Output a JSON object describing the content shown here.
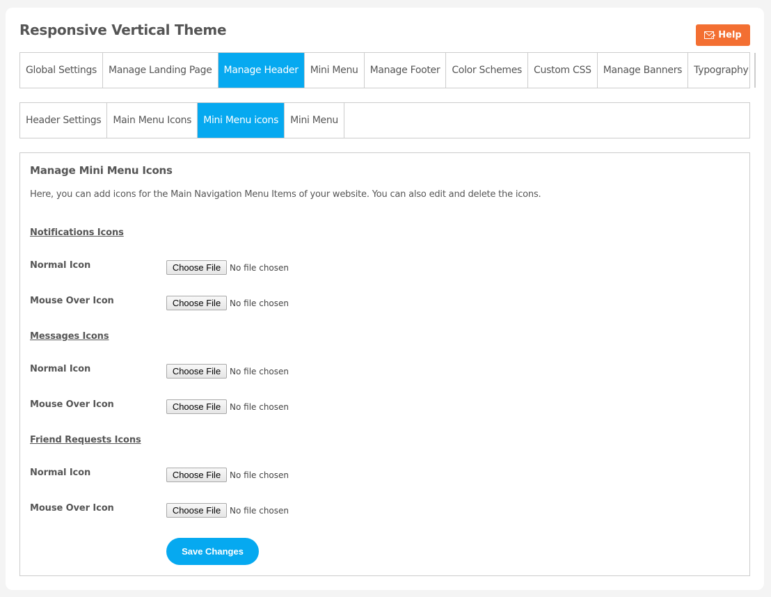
{
  "page": {
    "title": "Responsive Vertical Theme",
    "help_label": "Help",
    "help_icon": "envelope-icon"
  },
  "main_tabs": [
    {
      "label": "Global Settings",
      "active": false
    },
    {
      "label": "Manage Landing Page",
      "active": false
    },
    {
      "label": "Manage Header",
      "active": true
    },
    {
      "label": "Mini Menu",
      "active": false
    },
    {
      "label": "Manage Footer",
      "active": false
    },
    {
      "label": "Color Schemes",
      "active": false
    },
    {
      "label": "Custom CSS",
      "active": false
    },
    {
      "label": "Manage Banners",
      "active": false
    },
    {
      "label": "Typography",
      "active": false
    }
  ],
  "sub_tabs": [
    {
      "label": "Header Settings",
      "active": false
    },
    {
      "label": "Main Menu Icons",
      "active": false
    },
    {
      "label": "Mini Menu icons",
      "active": true
    },
    {
      "label": "Mini Menu",
      "active": false
    }
  ],
  "panel": {
    "title": "Manage Mini Menu Icons",
    "description": "Here, you can add icons for the Main Navigation Menu Items of your website. You can also edit and delete the icons.",
    "sections": [
      {
        "heading": "Notifications Icons",
        "fields": [
          {
            "label": "Normal Icon",
            "button": "Choose File",
            "status": "No file chosen"
          },
          {
            "label": "Mouse Over Icon",
            "button": "Choose File",
            "status": "No file chosen"
          }
        ]
      },
      {
        "heading": "Messages Icons",
        "fields": [
          {
            "label": "Normal Icon",
            "button": "Choose File",
            "status": "No file chosen"
          },
          {
            "label": "Mouse Over Icon",
            "button": "Choose File",
            "status": "No file chosen"
          }
        ]
      },
      {
        "heading": "Friend Requests Icons",
        "fields": [
          {
            "label": "Normal Icon",
            "button": "Choose File",
            "status": "No file chosen"
          },
          {
            "label": "Mouse Over Icon",
            "button": "Choose File",
            "status": "No file chosen"
          }
        ]
      }
    ],
    "save_label": "Save Changes"
  },
  "colors": {
    "accent": "#06a9f0",
    "help_button": "#f36f32",
    "text": "#555555",
    "border": "#cccccc",
    "page_bg": "#f4f4f4"
  }
}
